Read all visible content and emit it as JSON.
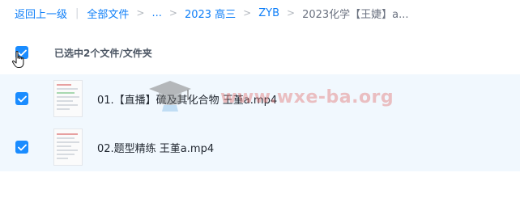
{
  "breadcrumb": {
    "back": "返回上一级",
    "all_files": "全部文件",
    "ellipsis": "...",
    "folder_2023": "2023 高三",
    "folder_zyb": "ZYB",
    "current": "2023化学【王婕】a..."
  },
  "selection": {
    "summary": "已选中2个文件/文件夹",
    "checked": true
  },
  "files": [
    {
      "name": "01.【直播】硫及其化合物 王堇a.mp4",
      "checked": true
    },
    {
      "name": "02.题型精练 王堇a.mp4",
      "checked": true
    }
  ],
  "watermark": {
    "text": "www.wxe-ba.org"
  },
  "colors": {
    "accent": "#1a8cff",
    "link": "#0f7ff8",
    "row_highlight": "#f1f8fe"
  }
}
